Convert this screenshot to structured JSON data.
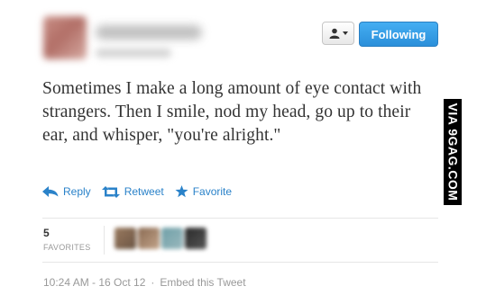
{
  "header": {
    "follow_button_label": "Following"
  },
  "tweet": {
    "text": "Sometimes I make a long amount of eye contact with strangers. Then I smile, nod my head, go up to their ear, and whisper, \"you're alright.\""
  },
  "actions": {
    "reply_label": "Reply",
    "retweet_label": "Retweet",
    "favorite_label": "Favorite"
  },
  "stats": {
    "favorites_count": "5",
    "favorites_label": "FAVORITES"
  },
  "footer": {
    "timestamp": "10:24 AM - 16 Oct 12",
    "separator": "·",
    "embed_label": "Embed this Tweet"
  },
  "watermark": {
    "text": "VIA 9GAG.COM"
  },
  "icons": {
    "user": "user-icon",
    "caret": "caret-down-icon",
    "reply": "reply-arrow-icon",
    "retweet": "retweet-icon",
    "favorite": "star-icon"
  },
  "colors": {
    "accent": "#2a82c9",
    "button_top": "#45aef2",
    "button_bottom": "#2b8fda",
    "text": "#333333",
    "muted": "#999999"
  }
}
